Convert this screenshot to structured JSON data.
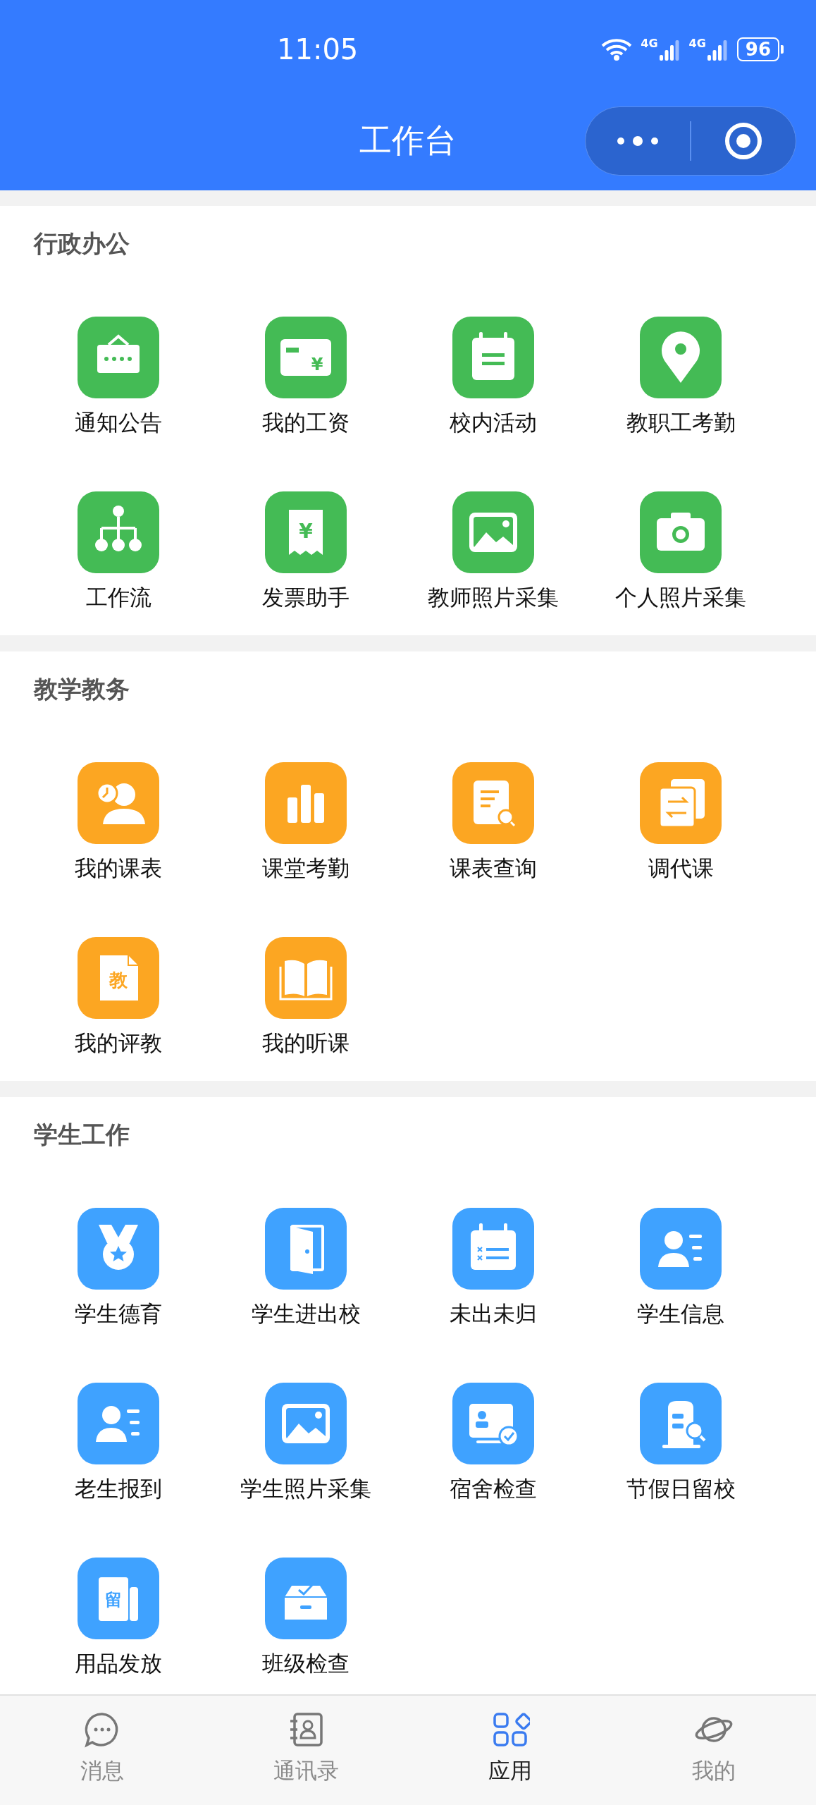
{
  "status_bar": {
    "time": "11:05",
    "networks": [
      {
        "label": "4G"
      },
      {
        "label": "4G"
      }
    ],
    "battery": "96"
  },
  "header": {
    "title": "工作台"
  },
  "sections": [
    {
      "title": "行政办公",
      "color": "#44bb55",
      "apps": [
        {
          "label": "通知公告"
        },
        {
          "label": "我的工资",
          "icon_text": "¥"
        },
        {
          "label": "校内活动"
        },
        {
          "label": "教职工考勤"
        },
        {
          "label": "工作流"
        },
        {
          "label": "发票助手",
          "icon_text": "¥"
        },
        {
          "label": "教师照片采集"
        },
        {
          "label": "个人照片采集"
        }
      ]
    },
    {
      "title": "教学教务",
      "color": "#fca622",
      "apps": [
        {
          "label": "我的课表"
        },
        {
          "label": "课堂考勤"
        },
        {
          "label": "课表查询"
        },
        {
          "label": "调代课"
        },
        {
          "label": "我的评教",
          "icon_text": "教"
        },
        {
          "label": "我的听课"
        }
      ]
    },
    {
      "title": "学生工作",
      "color": "#3fa2ff",
      "apps": [
        {
          "label": "学生德育"
        },
        {
          "label": "学生进出校"
        },
        {
          "label": "未出未归"
        },
        {
          "label": "学生信息"
        },
        {
          "label": "老生报到"
        },
        {
          "label": "学生照片采集"
        },
        {
          "label": "宿舍检查"
        },
        {
          "label": "节假日留校"
        },
        {
          "label": "用品发放",
          "icon_text": "留"
        },
        {
          "label": "班级检查"
        }
      ]
    }
  ],
  "tab_bar": [
    {
      "label": "消息",
      "selected": false
    },
    {
      "label": "通讯录",
      "selected": false
    },
    {
      "label": "应用",
      "selected": true
    },
    {
      "label": "我的",
      "selected": false
    }
  ]
}
